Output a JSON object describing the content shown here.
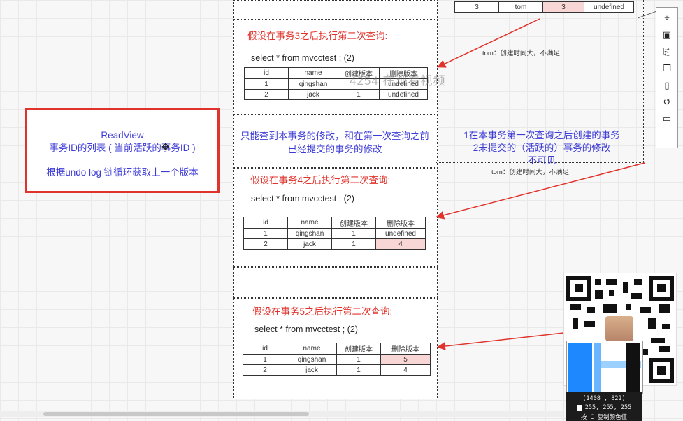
{
  "top_table": {
    "row": [
      "3",
      "tom",
      "3",
      "undefined"
    ]
  },
  "note_tom_1": "tom：创建时间大，不满足",
  "note_tom_2": "tom：创建时间大，不满足",
  "watermark": "4254 在观看视频",
  "readview": {
    "title": "ReadView",
    "line1": "事务ID的列表 ( 当前活跃的事务ID )",
    "line2": "根据undo log 链循环获取上一个版本"
  },
  "middle_note": {
    "line1": "只能查到本事务的修改，和在第一次查询之前",
    "line2": "已经提交的事务的修改"
  },
  "right_note": {
    "line1": "1在本事务第一次查询之后创建的事务",
    "line2": "2未提交的（活跃的）事务的修改",
    "line3": "不可见"
  },
  "columns": [
    "id",
    "name",
    "创建版本",
    "删除版本"
  ],
  "blocks": [
    {
      "title": "假设在事务3之后执行第二次查询:",
      "sql": "select * from mvcctest ;  (2)",
      "rows": [
        [
          "1",
          "qingshan",
          "",
          "undefined"
        ],
        [
          "2",
          "jack",
          "1",
          "undefined"
        ]
      ]
    },
    {
      "title": "假设在事务4之后执行第二次查询:",
      "sql": "select * from mvcctest ;  (2)",
      "rows": [
        [
          "1",
          "qingshan",
          "1",
          "undefined"
        ],
        [
          "2",
          "jack",
          "1",
          "4"
        ]
      ]
    },
    {
      "title": "假设在事务5之后执行第二次查询:",
      "sql": "select * from mvcctest ;  (2)",
      "rows": [
        [
          "1",
          "qingshan",
          "1",
          "5"
        ],
        [
          "2",
          "jack",
          "1",
          "4"
        ]
      ]
    }
  ],
  "color_picker": {
    "coords": "(1408 , 822)",
    "rgb": "255, 255, 255",
    "hint": "按 C 复制颜色值"
  },
  "colors": {
    "accent_red": "#e0332c",
    "text_blue": "#3d3bd6",
    "highlight_pink": "#f8d6d6"
  }
}
